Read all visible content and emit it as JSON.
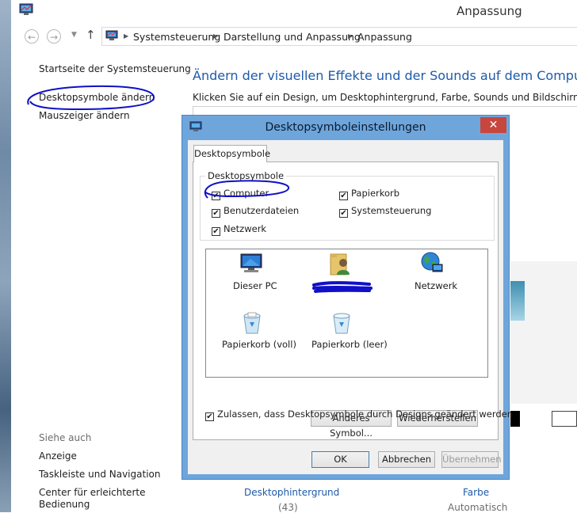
{
  "window": {
    "title": "Anpassung"
  },
  "address": {
    "crumbs": [
      "Systemsteuerung",
      "Darstellung und Anpassung",
      "Anpassung"
    ]
  },
  "left_nav": {
    "home": "Startseite der Systemsteuerung",
    "desktop_icons": "Desktopsymbole ändern",
    "mouse_pointer": "Mauszeiger ändern",
    "see_also_heading": "Siehe auch",
    "see_also": [
      "Anzeige",
      "Taskleiste und Navigation",
      "Center für erleichterte",
      "Bedienung"
    ]
  },
  "main": {
    "title": "Ändern der visuellen Effekte und der Sounds auf dem Computer",
    "description": "Klicken Sie auf ein Design, um Desktophintergrund, Farbe, Sounds und Bildschirmschoner gl",
    "bottom": {
      "background_label": "Desktophintergrund",
      "background_count": "(43)",
      "color_label": "Farbe",
      "color_value": "Automatisch"
    }
  },
  "dialog": {
    "title": "Desktopsymboleinstellungen",
    "close_glyph": "✕",
    "tab_label": "Desktopsymbole",
    "group_label": "Desktopsymbole",
    "checkboxes": {
      "computer": {
        "label": "Computer",
        "checked": true
      },
      "recycle_bin": {
        "label": "Papierkorb",
        "checked": true
      },
      "user_files": {
        "label": "Benutzerdateien",
        "checked": true
      },
      "control_panel": {
        "label": "Systemsteuerung",
        "checked": true
      },
      "network": {
        "label": "Netzwerk",
        "checked": true
      }
    },
    "icons": {
      "this_pc": "Dieser PC",
      "network": "Netzwerk",
      "bin_full": "Papierkorb (voll)",
      "bin_empty": "Papierkorb (leer)"
    },
    "buttons": {
      "change_icon": "Anderes Symbol...",
      "restore": "Wiederherstellen",
      "ok": "OK",
      "cancel": "Abbrechen",
      "apply": "Übernehmen"
    },
    "allow_themes": {
      "label": "Zulassen, dass Desktopsymbole durch Designs geändert werden",
      "checked": true
    }
  },
  "colors": {
    "link_blue": "#1e5aa8",
    "dialog_frame": "#6ea6dc",
    "close_red": "#c7463e",
    "scribble_blue": "#1010c8"
  }
}
